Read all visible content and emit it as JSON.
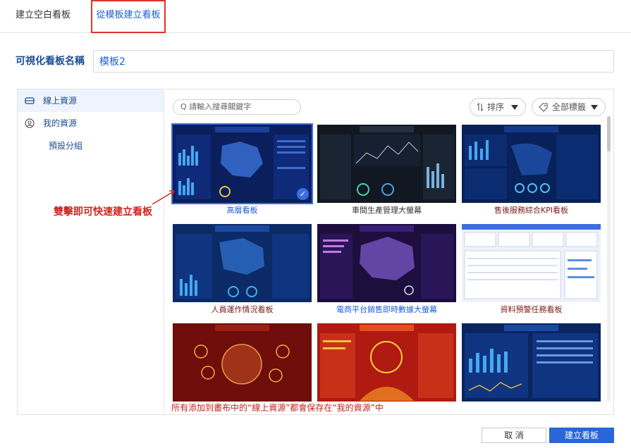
{
  "tabs": [
    {
      "label": "建立空白看板"
    },
    {
      "label": "從模板建立看板"
    }
  ],
  "name_field": {
    "label": "可視化看板名稱",
    "value": "模板2"
  },
  "sidebar": {
    "items": [
      {
        "label": "線上資源",
        "icon": "cloud-server-icon"
      },
      {
        "label": "我的資源",
        "icon": "user-circle-icon"
      },
      {
        "label": "預設分組"
      }
    ]
  },
  "toolbar": {
    "search_placeholder": "Q 請輸入搜尋關鍵字",
    "sort_label": "排序",
    "tag_label": "全部標籤"
  },
  "templates": [
    {
      "title": "高層看板",
      "selected": true
    },
    {
      "title": "車間生產管理大螢幕"
    },
    {
      "title": "售後服務綜合KPI看板"
    },
    {
      "title": "人員運作情況看板"
    },
    {
      "title": "電商平台銷售即時數據大螢幕"
    },
    {
      "title": "資料預警任務看板"
    },
    {
      "title": ""
    },
    {
      "title": ""
    },
    {
      "title": ""
    }
  ],
  "annotations": {
    "hint": "雙擊即可快速建立看板",
    "note": "所有添加到畫布中的“線上資源”都會保存在“我的資源”中"
  },
  "footer": {
    "cancel_label": "取 消",
    "create_label": "建立看板"
  },
  "colors": {
    "accent": "#2a66d8",
    "annotation": "#d0241e",
    "highlight": "#e0312e"
  }
}
